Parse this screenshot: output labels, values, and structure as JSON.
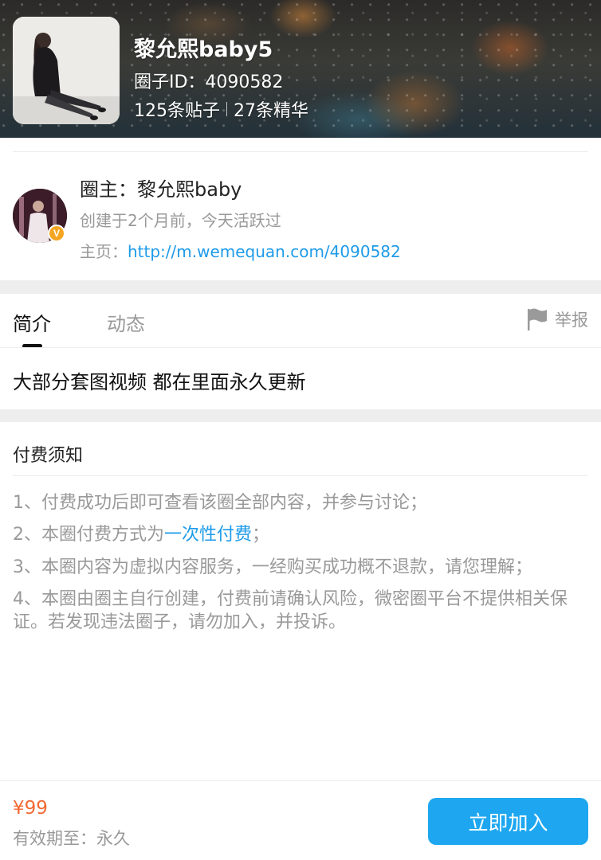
{
  "header": {
    "circle_name": "黎允熙baby5",
    "circle_id": "圈子ID：4090582",
    "posts_count": "125条贴子",
    "essence_count": "27条精华"
  },
  "owner": {
    "title": "圈主：黎允熙baby",
    "created": "创建于2个月前，今天活跃过",
    "homepage_label": "主页：",
    "homepage_url": "http://m.wemequan.com/4090582",
    "badge": "V"
  },
  "tabs": [
    {
      "label": "简介",
      "active": true
    },
    {
      "label": "动态",
      "active": false
    }
  ],
  "report_label": "举报",
  "intro": "大部分套图视频 都在里面永久更新",
  "notice": {
    "title": "付费须知",
    "items": [
      {
        "text": "1、付费成功后即可查看该圈全部内容，并参与讨论；"
      },
      {
        "prefix": "2、本圈付费方式为",
        "highlight": "一次性付费",
        "suffix": "；"
      },
      {
        "text": "3、本圈内容为虚拟内容服务，一经购买成功概不退款，请您理解；"
      },
      {
        "text": "4、本圈由圈主自行创建，付费前请确认风险，微密圈平台不提供相关保证。若发现违法圈子，请勿加入，并投诉。"
      }
    ]
  },
  "footer": {
    "price": "¥99",
    "validity": "有效期至：永久",
    "join_label": "立即加入"
  },
  "colors": {
    "accent_blue": "#1e9be9",
    "button_blue": "#1ea7f0",
    "price_orange": "#f26a34",
    "badge_gold": "#f4a623"
  }
}
